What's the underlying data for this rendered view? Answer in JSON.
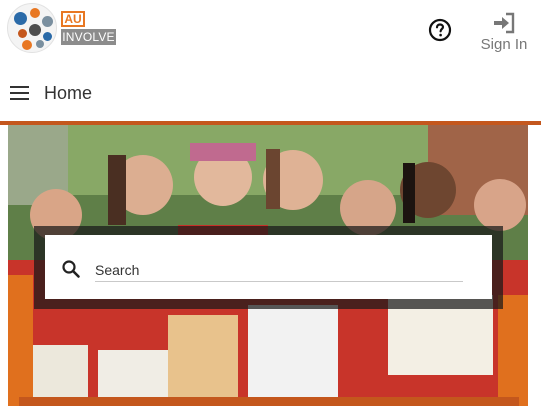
{
  "brand": {
    "badge_top": "AU",
    "badge_bottom": "INVOLVE",
    "logo_icon": "globe-collage-icon"
  },
  "header": {
    "help_icon": "question-circle-icon",
    "signin_icon": "sign-in-icon",
    "signin_label": "Sign In"
  },
  "nav": {
    "menu_icon": "hamburger-menu-icon",
    "title": "Home"
  },
  "search": {
    "placeholder": "Search",
    "icon": "search-icon"
  },
  "colors": {
    "accent": "#c4571d",
    "brand_orange": "#e87722",
    "badge_gray": "#8c8c8c"
  }
}
